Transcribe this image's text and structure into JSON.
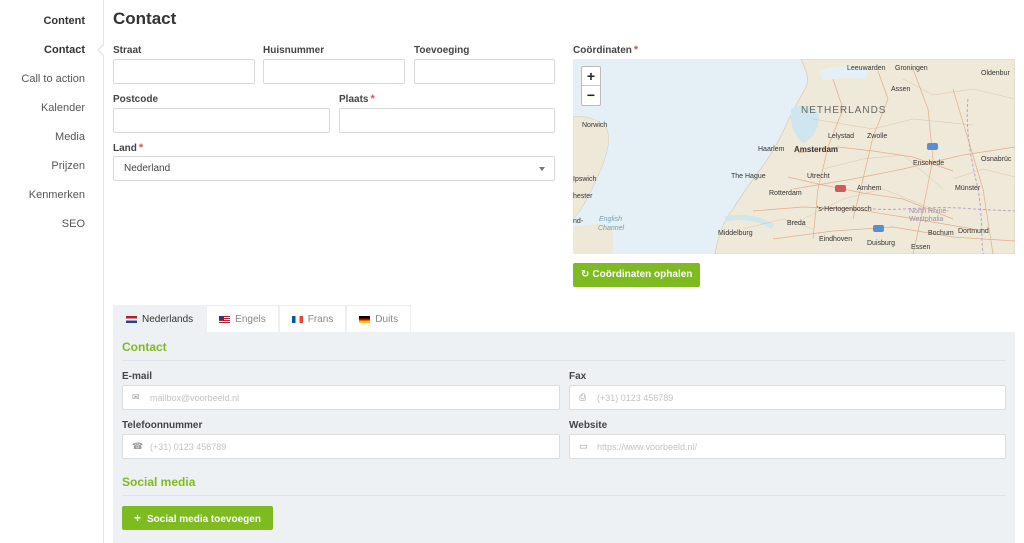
{
  "sidebar": {
    "items": [
      {
        "label": "Content"
      },
      {
        "label": "Contact"
      },
      {
        "label": "Call to action"
      },
      {
        "label": "Kalender"
      },
      {
        "label": "Media"
      },
      {
        "label": "Prijzen"
      },
      {
        "label": "Kenmerken"
      },
      {
        "label": "SEO"
      }
    ],
    "active": "Contact"
  },
  "page": {
    "title": "Contact"
  },
  "address": {
    "straat": {
      "label": "Straat",
      "value": ""
    },
    "huisnummer": {
      "label": "Huisnummer",
      "value": ""
    },
    "toevoeging": {
      "label": "Toevoeging",
      "value": ""
    },
    "postcode": {
      "label": "Postcode",
      "value": ""
    },
    "plaats": {
      "label": "Plaats",
      "value": "",
      "required_mark": "*"
    },
    "land": {
      "label": "Land",
      "value": "Nederland",
      "required_mark": "*"
    }
  },
  "map": {
    "label": "Coördinaten",
    "required_mark": "*",
    "zoom_in": "+",
    "zoom_out": "−",
    "places": {
      "leeuwarden": "Leeuwarden",
      "groningen": "Groningen",
      "oldenburg": "Oldenbur",
      "assen": "Assen",
      "netherlands": "NETHERLANDS",
      "norwich": "Norwich",
      "lelystad": "Lelystad",
      "zwolle": "Zwolle",
      "haarlem": "Haarlem",
      "amsterdam": "Amsterdam",
      "enschede": "Enschede",
      "osnabruck": "Osnabrüc",
      "ipswich": "Ipswich",
      "the_hague": "The Hague",
      "utrecht": "Utrecht",
      "rotterdam": "Rotterdam",
      "arnhem": "Arnhem",
      "munster": "Münster",
      "colchester": "hester",
      "hertogenbosch": "'s-Hertogenbosch",
      "north_rhine": "North Rhine-Westphalia",
      "english_channel_1": "English",
      "english_channel_2": "Channel",
      "southend": "nd-",
      "middelburg": "Middelburg",
      "breda": "Breda",
      "bochum": "Bochum",
      "dortmund": "Dortmund",
      "eindhoven": "Eindhoven",
      "duisburg": "Duisburg",
      "essen": "Essen"
    },
    "fetch_button": "Coördinaten ophalen"
  },
  "tabs": [
    {
      "label": "Nederlands",
      "active": true
    },
    {
      "label": "Engels",
      "active": false
    },
    {
      "label": "Frans",
      "active": false
    },
    {
      "label": "Duits",
      "active": false
    }
  ],
  "contact": {
    "title": "Contact",
    "email": {
      "label": "E-mail",
      "placeholder": "mailbox@voorbeeld.nl",
      "icon": "envelope-icon"
    },
    "fax": {
      "label": "Fax",
      "placeholder": "(+31) 0123 456789",
      "icon": "printer-icon"
    },
    "telefoon": {
      "label": "Telefoonnummer",
      "placeholder": "(+31) 0123 456789",
      "icon": "phone-icon"
    },
    "website": {
      "label": "Website",
      "placeholder": "https://www.voorbeeld.nl/",
      "icon": "monitor-icon"
    }
  },
  "social": {
    "title": "Social media",
    "add_button": "Social media toevoegen",
    "add_icon": "+"
  },
  "colors": {
    "accent": "#7dbb21",
    "required": "#d9534f",
    "panel": "#eef1f3"
  }
}
